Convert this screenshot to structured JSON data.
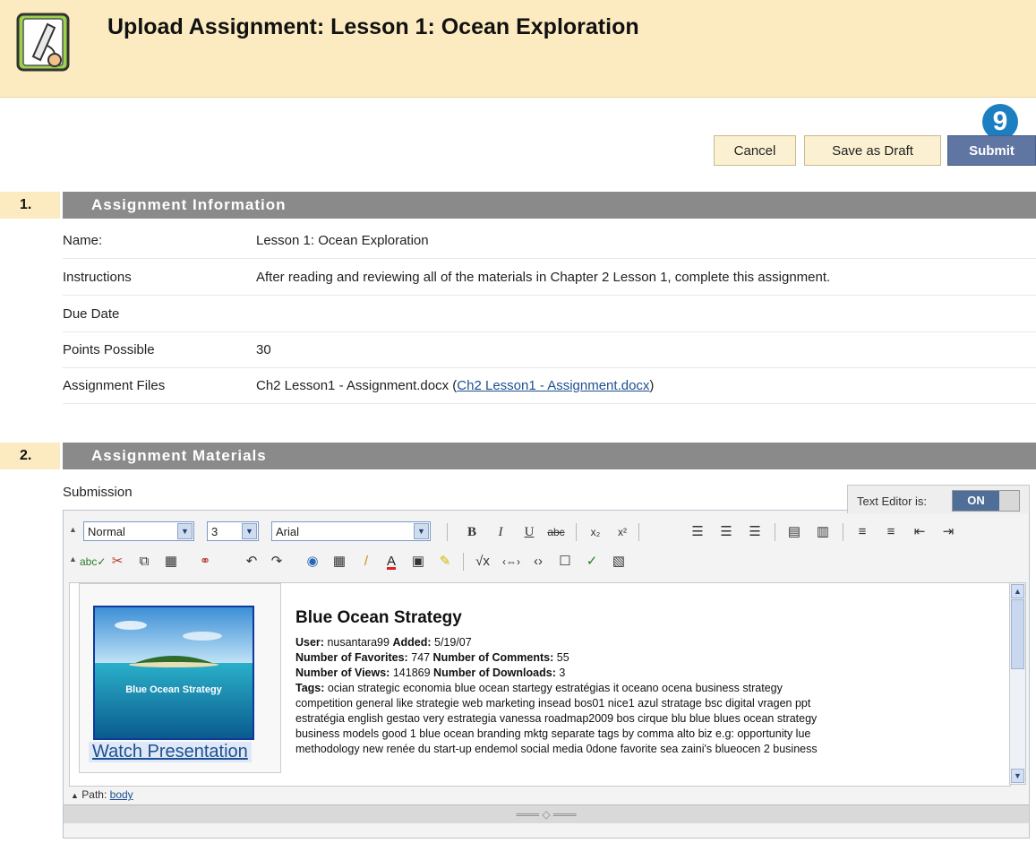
{
  "header": {
    "title": "Upload Assignment: Lesson 1: Ocean Exploration",
    "icon": "pen-document-icon"
  },
  "step_badge": "9",
  "actions": {
    "cancel": "Cancel",
    "save_draft": "Save as Draft",
    "submit": "Submit"
  },
  "section1": {
    "number": "1.",
    "title": "Assignment Information",
    "rows": [
      {
        "label": "Name:",
        "value": "Lesson 1: Ocean Exploration"
      },
      {
        "label": "Instructions",
        "value": "After reading and reviewing all of the materials in Chapter 2 Lesson 1, complete this assignment."
      },
      {
        "label": "Due Date",
        "value": ""
      },
      {
        "label": "Points Possible",
        "value": "30"
      },
      {
        "label": "Assignment Files",
        "value": "Ch2 Lesson1 - Assignment.docx (",
        "link": "Ch2 Lesson1 - Assignment.docx",
        "suffix": ")"
      }
    ]
  },
  "section2": {
    "number": "2.",
    "title": "Assignment Materials",
    "submission_label": "Submission",
    "text_editor_label": "Text Editor is:",
    "text_editor_state": "ON"
  },
  "toolbar": {
    "format": "Normal",
    "size": "3",
    "font": "Arial"
  },
  "content": {
    "thumb_caption": "Blue Ocean Strategy",
    "watch_link": "Watch Presentation",
    "title": "Blue Ocean Strategy",
    "user_label": "User:",
    "user": "nusantara99",
    "added_label": "Added:",
    "added": "5/19/07",
    "favorites_label": "Number of Favorites:",
    "favorites": "747",
    "comments_label": "Number of Comments:",
    "comments": "55",
    "views_label": "Number of Views:",
    "views": "141869",
    "downloads_label": "Number of Downloads:",
    "downloads": "3",
    "tags_label": "Tags:",
    "tags_line1": "ocian strategic economia blue ocean startegy estratégias it oceano ocena business strategy",
    "tags_line2": "competition general like strategie web marketing insead bos01 nice1 azul stratage bsc digital vragen ppt",
    "tags_line3": "estratégia english gestao very estrategia vanessa roadmap2009 bos cirque blu blue blues ocean strategy",
    "tags_line4": "business models good 1 blue ocean branding mktg separate tags by comma alto biz e.g: opportunity lue",
    "tags_line5": "methodology new renée du start-up endemol social media 0done favorite sea zaini's blueocen 2 business"
  },
  "path": {
    "label": "Path:",
    "value": "body"
  }
}
